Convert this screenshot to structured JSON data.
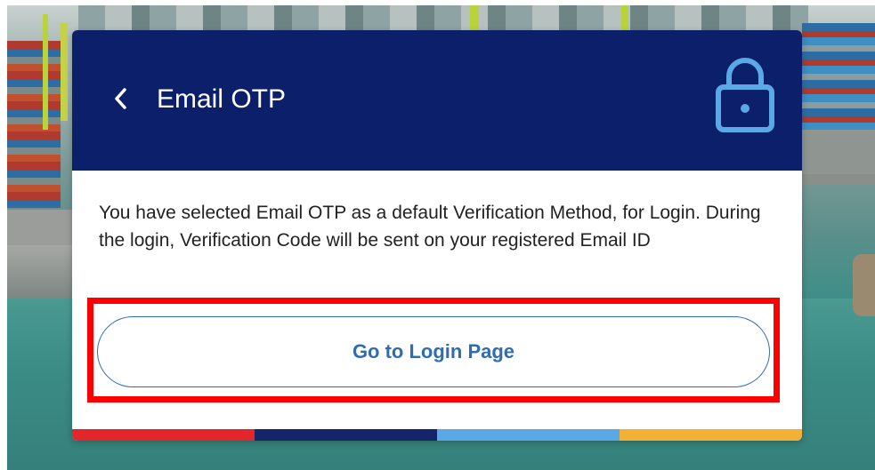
{
  "dialog": {
    "title": "Email OTP",
    "back_icon": "chevron-left-icon",
    "lock_icon": "lock-icon",
    "message": "You have selected Email OTP as a default Verification Method, for Login. During the login, Verification Code will be sent on your registered Email ID",
    "login_button_label": "Go to Login Page"
  },
  "colors": {
    "header": "#0c1f6b",
    "lock_icon": "#5aa9e6",
    "button_text": "#2f6db0",
    "highlight": "#ff0000",
    "stripes": [
      "#e3262c",
      "#16246a",
      "#5aa9e6",
      "#f2b134"
    ]
  }
}
